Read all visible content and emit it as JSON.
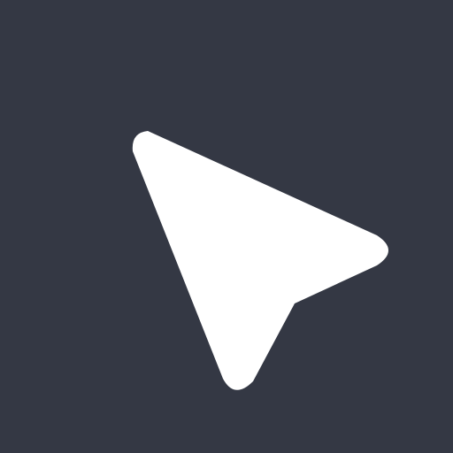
{
  "icon": {
    "name": "cursor-arrow-icon"
  },
  "colors": {
    "background": "#343844",
    "icon": "#ffffff"
  }
}
